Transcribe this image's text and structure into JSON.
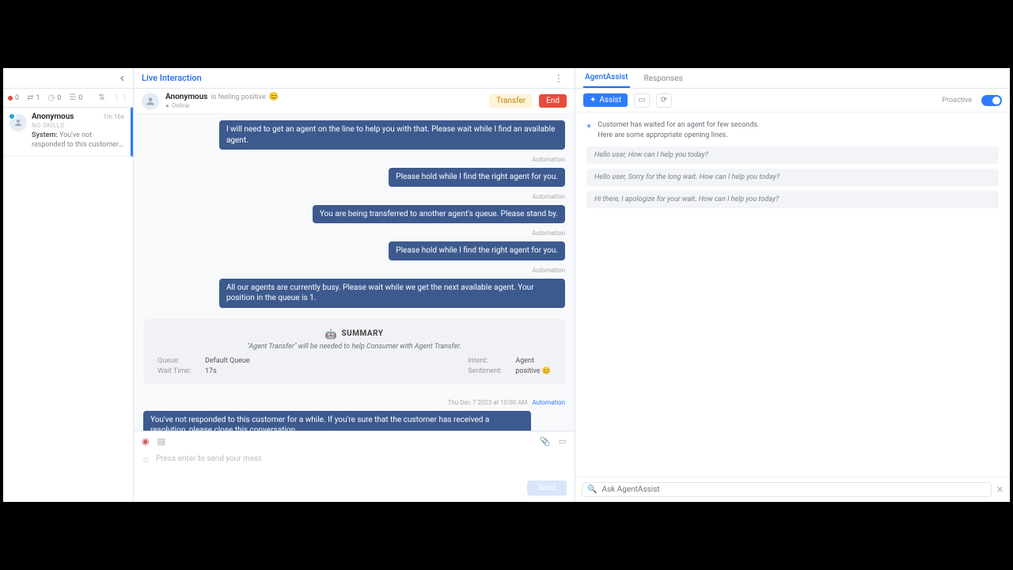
{
  "left": {
    "statuses": [
      {
        "count": "0"
      },
      {
        "count": "1"
      },
      {
        "count": "0"
      },
      {
        "count": "0"
      }
    ],
    "conversation": {
      "name": "Anonymous",
      "time": "1m 16s",
      "skills": "NO SKILLS",
      "snippet_prefix": "System:",
      "snippet": "You've not responded to this customer for a while. If you're sur..."
    }
  },
  "mid": {
    "title": "Live Interaction",
    "sub": {
      "name": "Anonymous",
      "feeling": "is feeling positive",
      "emoji": "😊",
      "online": "Online"
    },
    "buttons": {
      "transfer": "Transfer",
      "end": "End"
    },
    "messages": [
      {
        "label": "",
        "text": "I will need to get an agent on the line to help you with that. Please wait while I find an available agent."
      },
      {
        "label": "Automation",
        "text": "Please hold while I find the right agent for you."
      },
      {
        "label": "Automation",
        "text": "You are being transferred to another agent's queue. Please stand by."
      },
      {
        "label": "Automation",
        "text": "Please hold while I find the right agent for you."
      },
      {
        "label": "Automation",
        "text": "All our agents are currently busy. Please wait while we get the next available agent. Your position in the queue is 1."
      }
    ],
    "summary": {
      "title": "SUMMARY",
      "quote": "\"Agent Transfer\" will be needed to help Consumer with Agent Transfer.",
      "rows_left": [
        {
          "k": "Queue:",
          "v": "Default Queue"
        },
        {
          "k": "Wait Time:",
          "v": "17s"
        }
      ],
      "rows_right": [
        {
          "k": "Intent:",
          "v": "Agent"
        },
        {
          "k": "Sentiment:",
          "v": "positive 😊"
        }
      ]
    },
    "footer_msg": {
      "timestamp": "Thu Dec 7 2023 at 10:00 AM",
      "automation": "Automation",
      "text": "You've not responded to this customer for a while. If you're sure that the customer has received a resolution, please close this conversation."
    },
    "composer": {
      "placeholder": "Press enter to send your message...",
      "send": "Send"
    }
  },
  "right": {
    "tabs": {
      "assist": "AgentAssist",
      "responses": "Responses"
    },
    "chip": "Assist",
    "proactive": "Proactive",
    "hint": "Customer has waited for an agent for few seconds.\nHere are some appropriate opening lines.",
    "suggestions": [
      "Hello user, How can I help you today?",
      "Hello user, Sorry for the long wait. How can I help you today?",
      "Hi there, I apologize for your wait. How can I help you today?"
    ],
    "search_placeholder": "Ask AgentAssist"
  }
}
